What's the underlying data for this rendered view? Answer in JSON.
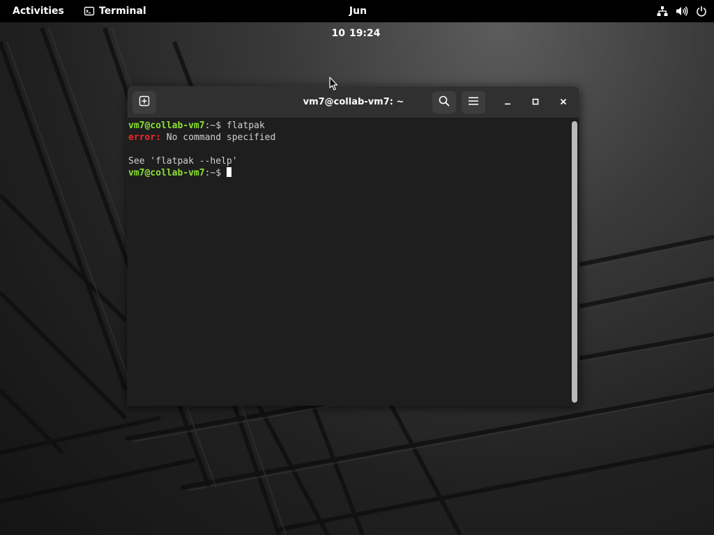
{
  "topbar": {
    "activities_label": "Activities",
    "app_name": "Terminal",
    "date": "Jun 10",
    "time": "19:24"
  },
  "window": {
    "title": "vm7@collab-vm7: ~"
  },
  "terminal": {
    "lines": [
      {
        "prompt": "vm7@collab-vm7",
        "sep": ":~$ ",
        "text": "flatpak"
      },
      {
        "label": "error:",
        "text": " No command specified"
      },
      {
        "text": ""
      },
      {
        "text": "See 'flatpak --help'"
      },
      {
        "prompt": "vm7@collab-vm7",
        "sep": ":~$ ",
        "text": ""
      }
    ]
  },
  "icons": {
    "app": "terminal-icon",
    "network": "network-icon",
    "volume": "volume-icon",
    "power": "power-icon",
    "new_tab": "new-tab-icon",
    "search": "search-icon",
    "menu": "hamburger-menu-icon",
    "minimize": "minimize-icon",
    "maximize": "maximize-icon",
    "close": "close-icon"
  },
  "colors": {
    "prompt": "#8ae234",
    "error": "#ef2929",
    "terminal_bg": "#1e1e1e",
    "headerbar_bg": "#303030",
    "topbar_bg": "#000000"
  }
}
